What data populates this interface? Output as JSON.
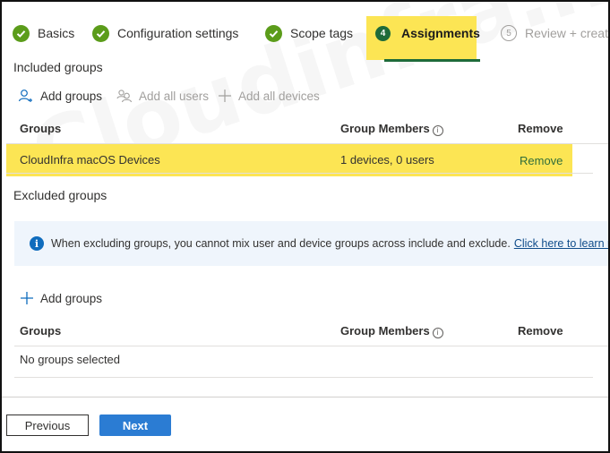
{
  "wizard": {
    "steps": [
      {
        "label": "Basics",
        "status": "completed",
        "icon": "check-circle-icon"
      },
      {
        "label": "Configuration settings",
        "status": "completed",
        "icon": "check-circle-icon"
      },
      {
        "label": "Scope tags",
        "status": "completed",
        "icon": "check-circle-icon"
      },
      {
        "label": "Assignments",
        "status": "current",
        "number": "4"
      },
      {
        "label": "Review + create",
        "status": "upcoming",
        "number": "5"
      }
    ]
  },
  "included": {
    "title": "Included groups",
    "commands": [
      {
        "label": "Add groups",
        "icon": "add-person-icon",
        "enabled": true
      },
      {
        "label": "Add all users",
        "icon": "people-icon",
        "enabled": false
      },
      {
        "label": "Add all devices",
        "icon": "plus-icon",
        "enabled": false
      }
    ],
    "columns": [
      "Groups",
      "Group Members",
      "Remove"
    ],
    "rows": [
      {
        "group": "CloudInfra macOS Devices",
        "members": "1 devices, 0 users",
        "remove": "Remove"
      }
    ]
  },
  "excluded": {
    "title": "Excluded groups",
    "info": {
      "text": "When excluding groups, you cannot mix user and device groups across include and exclude.",
      "link": "Click here to learn more a"
    },
    "commands": [
      {
        "label": "Add groups",
        "icon": "plus-icon",
        "enabled": true
      }
    ],
    "columns": [
      "Groups",
      "Group Members",
      "Remove"
    ],
    "empty_text": "No groups selected"
  },
  "footer": {
    "previous_label": "Previous",
    "next_label": "Next"
  },
  "watermark": "Cloudinfra.net",
  "colors": {
    "highlight": "#fce554",
    "completed": "#5b9c1a",
    "current": "#1e6b3a",
    "primary": "#2b7cd3"
  }
}
